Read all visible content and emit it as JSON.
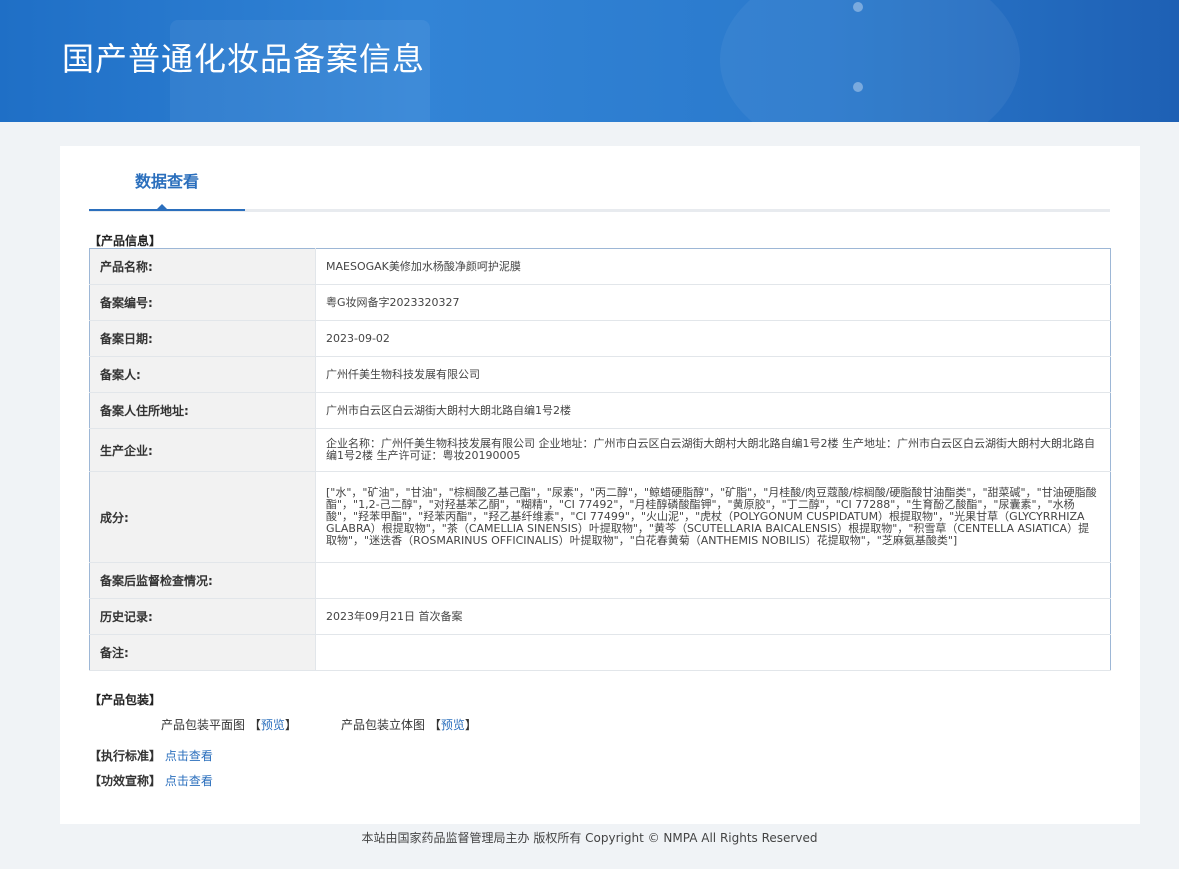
{
  "header": {
    "title": "国产普通化妆品备案信息"
  },
  "tabs": {
    "active": "数据查看"
  },
  "product_info": {
    "section_label": "【产品信息】",
    "rows": [
      {
        "label": "产品名称:",
        "value": "MAESOGAK美修加水杨酸净颜呵护泥膜"
      },
      {
        "label": "备案编号:",
        "value": "粤G妆网备字2023320327"
      },
      {
        "label": "备案日期:",
        "value": "2023-09-02"
      },
      {
        "label": "备案人:",
        "value": "广州仟美生物科技发展有限公司"
      },
      {
        "label": "备案人住所地址:",
        "value": "广州市白云区白云湖街大朗村大朗北路自编1号2楼"
      },
      {
        "label": "生产企业:",
        "value": "企业名称：广州仟美生物科技发展有限公司 企业地址：广州市白云区白云湖街大朗村大朗北路自编1号2楼 生产地址：广州市白云区白云湖街大朗村大朗北路自编1号2楼 生产许可证：粤妆20190005"
      },
      {
        "label": "成分:",
        "value": "[\"水\"，\"矿油\"，\"甘油\"，\"棕榈酸乙基己酯\"，\"尿素\"，\"丙二醇\"，\"鲸蜡硬脂醇\"，\"矿脂\"，\"月桂酸/肉豆蔻酸/棕榈酸/硬脂酸甘油酯类\"，\"甜菜碱\"，\"甘油硬脂酸酯\"，\"1,2-己二醇\"，\"对羟基苯乙酮\"，\"糊精\"，\"CI 77492\"，\"月桂醇磷酸酯钾\"，\"黄原胶\"，\"丁二醇\"，\"CI 77288\"，\"生育酚乙酸酯\"，\"尿囊素\"，\"水杨酸\"，\"羟苯甲酯\"，\"羟苯丙酯\"，\"羟乙基纤维素\"，\"CI 77499\"，\"火山泥\"，\"虎杖（POLYGONUM CUSPIDATUM）根提取物\"，\"光果甘草（GLYCYRRHIZA GLABRA）根提取物\"，\"茶（CAMELLIA SINENSIS）叶提取物\"，\"黄芩（SCUTELLARIA BAICALENSIS）根提取物\"，\"积雪草（CENTELLA ASIATICA）提取物\"，\"迷迭香（ROSMARINUS OFFICINALIS）叶提取物\"，\"白花春黄菊（ANTHEMIS NOBILIS）花提取物\"，\"芝麻氨基酸类\"]"
      },
      {
        "label": "备案后监督检查情况:",
        "value": ""
      },
      {
        "label": "历史记录:",
        "value": "2023年09月21日 首次备案"
      },
      {
        "label": "备注:",
        "value": ""
      }
    ]
  },
  "packaging": {
    "section_label": "【产品包装】",
    "flat_label": "产品包装平面图",
    "flat_link": "预览",
    "solid_label": "产品包装立体图",
    "solid_link": "预览"
  },
  "standard": {
    "label": "【执行标准】",
    "link": "点击查看"
  },
  "efficacy": {
    "label": "【功效宣称】",
    "link": "点击查看"
  },
  "footer": {
    "text": "本站由国家药品监督管理局主办 版权所有 Copyright © NMPA All Rights Reserved"
  },
  "colors": {
    "banner": "#2a79cc",
    "accent": "#2b6fbd",
    "table_border": "#9db7d6",
    "label_bg": "#f2f2f2"
  }
}
